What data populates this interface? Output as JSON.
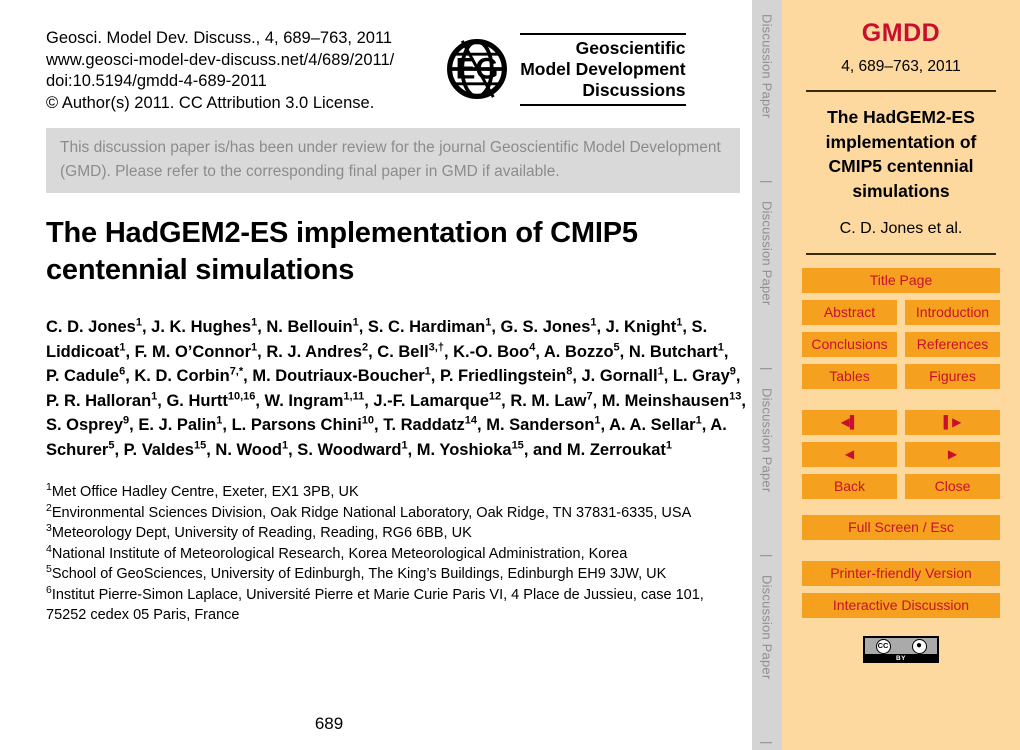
{
  "header": {
    "journal_ref_lines": [
      "Geosci. Model Dev. Discuss., 4, 689–763, 2011",
      "www.geosci-model-dev-discuss.net/4/689/2011/",
      "doi:10.5194/gmdd-4-689-2011",
      "© Author(s) 2011. CC Attribution 3.0 License."
    ],
    "logo_lines": [
      "Geoscientific",
      "Model Development",
      "Discussions"
    ],
    "logo_alt": "EGU logo"
  },
  "notice": "This discussion paper is/has been under review for the journal Geoscientific Model Development (GMD). Please refer to the corresponding final paper in GMD if available.",
  "paper": {
    "title": "The HadGEM2-ES implementation of CMIP5 centennial simulations",
    "authors_html": "C. D. Jones<sup>1</sup>, J. K. Hughes<sup>1</sup>, N. Bellouin<sup>1</sup>, S. C. Hardiman<sup>1</sup>, G. S. Jones<sup>1</sup>, J. Knight<sup>1</sup>, S. Liddicoat<sup>1</sup>, F. M. O’Connor<sup>1</sup>, R. J. Andres<sup>2</sup>, C. Bell<sup>3,†</sup>, K.-O. Boo<sup>4</sup>, A. Bozzo<sup>5</sup>, N. Butchart<sup>1</sup>, P. Cadule<sup>6</sup>, K. D. Corbin<sup>7,*</sup>, M. Doutriaux-Boucher<sup>1</sup>, P. Friedlingstein<sup>8</sup>, J. Gornall<sup>1</sup>, L. Gray<sup>9</sup>, P. R. Halloran<sup>1</sup>, G. Hurtt<sup>10,16</sup>, W. Ingram<sup>1,11</sup>, J.-F. Lamarque<sup>12</sup>, R. M. Law<sup>7</sup>, M. Meinshausen<sup>13</sup>, S. Osprey<sup>9</sup>, E. J. Palin<sup>1</sup>, L. Parsons Chini<sup>10</sup>, T. Raddatz<sup>14</sup>, M. Sanderson<sup>1</sup>, A. A. Sellar<sup>1</sup>, A. Schurer<sup>5</sup>, P. Valdes<sup>15</sup>, N. Wood<sup>1</sup>, S. Woodward<sup>1</sup>, M. Yoshioka<sup>15</sup>, and M. Zerroukat<sup>1</sup>",
    "affiliations_html": "<div class=\"affil-line\"><sup>1</sup>Met Office Hadley Centre, Exeter, EX1 3PB, UK</div><div class=\"affil-line\"><sup>2</sup>Environmental Sciences Division, Oak Ridge National Laboratory, Oak Ridge, TN 37831-6335, USA</div><div class=\"affil-line\"><sup>3</sup>Meteorology Dept, University of Reading, Reading, RG6 6BB, UK</div><div class=\"affil-line\"><sup>4</sup>National Institute of Meteorological Research, Korea Meteorological Administration, Korea</div><div class=\"affil-line\"><sup>5</sup>School of GeoSciences, University of Edinburgh, The King’s Buildings, Edinburgh EH9 3JW, UK</div><div class=\"affil-line\"><sup>6</sup>Institut Pierre-Simon Laplace, Université Pierre et Marie Curie Paris VI, 4 Place de Jussieu, case 101, 75252 cedex 05 Paris, France</div>",
    "page_number": "689"
  },
  "discussion_bar": {
    "segments": [
      "Discussion Paper",
      "Discussion Paper",
      "Discussion Paper",
      "Discussion Paper"
    ],
    "divider": "|"
  },
  "sidebar": {
    "journal_abbrev": "GMDD",
    "volume_line": "4, 689–763, 2011",
    "title": "The HadGEM2-ES implementation of CMIP5 centennial simulations",
    "authors": "C. D. Jones et al.",
    "buttons": {
      "title_page": "Title Page",
      "abstract": "Abstract",
      "introduction": "Introduction",
      "conclusions": "Conclusions",
      "references": "References",
      "tables": "Tables",
      "figures": "Figures",
      "first": "◀▌",
      "last": "▌▶",
      "prev": "◀",
      "next": "▶",
      "back": "Back",
      "close": "Close",
      "full_screen": "Full Screen / Esc",
      "printer_friendly": "Printer-friendly Version",
      "interactive_discussion": "Interactive Discussion"
    },
    "license_badge": {
      "cc_label": "CC",
      "by_label": "BY"
    }
  },
  "colors": {
    "accent_red": "#c8102e",
    "button_orange": "#f5a01e",
    "sidebar_bg": "#fdd9a0",
    "notice_bg": "#d9d9d9",
    "bar_gray": "#d4d4d4"
  }
}
